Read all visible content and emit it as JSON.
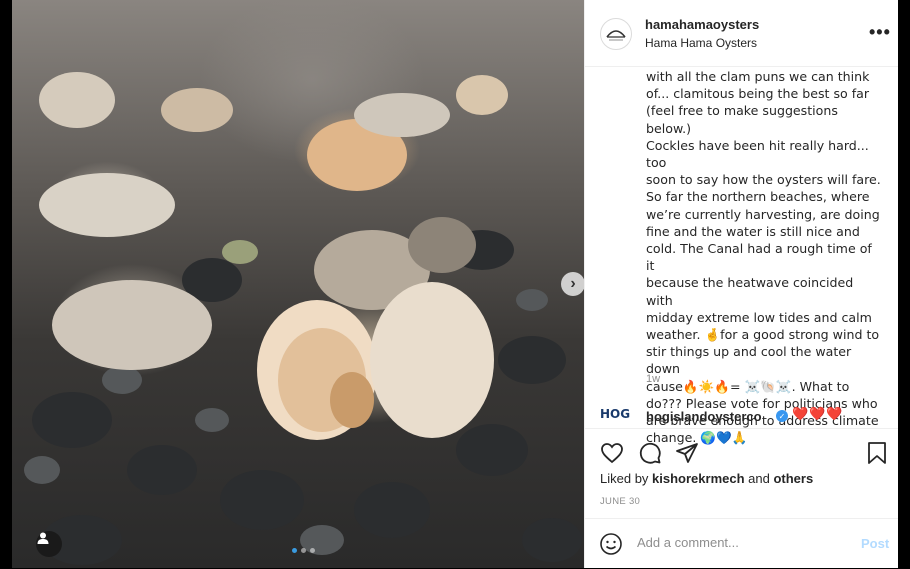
{
  "post": {
    "username": "hamahamaoysters",
    "display_name": "Hama Hama Oysters",
    "more_label": "•••",
    "caption_lines": [
      "with all the clam puns we can think",
      "of... clamitous being the best so far",
      "(feel free to make suggestions below.)",
      "Cockles have been hit really hard... too",
      "soon to say how the oysters will fare.",
      "So far the northern beaches, where",
      "we’re currently harvesting, are doing",
      "fine and the water is still nice and",
      "cold. The Canal had a rough time of it",
      "because the heatwave coincided with",
      "midday extreme low tides and calm",
      "weather. 🤞for a good strong wind to",
      "stir things up and cool the water down",
      "cause🔥☀️🔥= ☠️🐚☠️. What to",
      "do??? Please vote for politicians who",
      "are brave enough to address climate",
      "change. 🌍💙🙏"
    ],
    "time_ago": "1w",
    "comment": {
      "avatar_text": "HOG",
      "username": "hogislandoysterco",
      "verified": "✓",
      "text": "❤️❤️❤️"
    },
    "likes": {
      "prefix": "Liked by ",
      "user": "kishorekrmech",
      "middle": " and ",
      "others": "others"
    },
    "date": "JUNE 30",
    "add_comment_placeholder": "Add a comment...",
    "post_label": "Post",
    "next_label": "›"
  }
}
